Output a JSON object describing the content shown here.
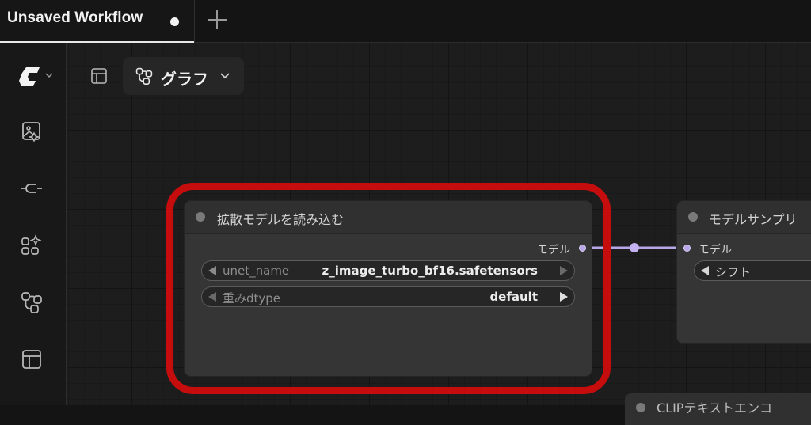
{
  "tab": {
    "title": "Unsaved Workflow"
  },
  "toolbar": {
    "graph_label": "グラフ"
  },
  "node_load": {
    "title": "拡散モデルを読み込む",
    "output_label": "モデル",
    "widgets": [
      {
        "label": "unet_name",
        "value": "z_image_turbo_bf16.safetensors"
      },
      {
        "label": "重みdtype",
        "value": "default"
      }
    ]
  },
  "node_sampling": {
    "title": "モデルサンプリ",
    "input_label": "モデル",
    "widget_label": "シフト"
  },
  "node_partial": {
    "title": "CLIPテキストエンコ"
  },
  "colors": {
    "highlight": "#c50d0d",
    "link": "#b7a6e8",
    "node_bg": "#353535",
    "canvas_bg": "#1d1d1d"
  },
  "icons": {
    "logo": "comfy-logo-icon",
    "sidebar": [
      "image-assets-icon",
      "node-library-icon",
      "templates-icon",
      "workflow-graph-icon",
      "layout-panel-icon"
    ]
  }
}
